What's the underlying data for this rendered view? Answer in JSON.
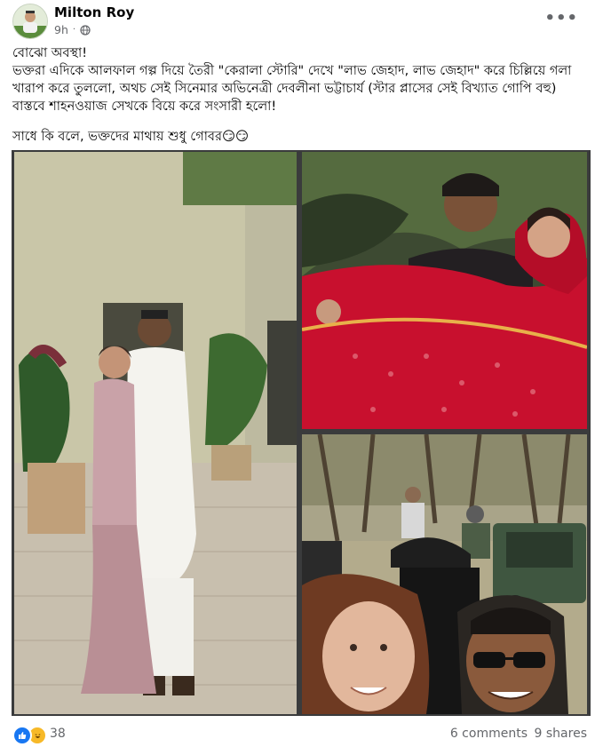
{
  "post": {
    "author": "Milton Roy",
    "time": "9h",
    "more_label": "•••",
    "text": {
      "line1": "বোঝো অবস্থা!",
      "line2": "ভক্তরা এদিকে আলফাল গল্প দিয়ে তৈরী \"কেরালা স্টোরি\" দেখে \"লাভ জেহাদ, লাভ জেহাদ\" করে চিল্লিয়ে গলা খারাপ করে তুললো, অথচ সেই সিনেমার অভিনেত্রী দেবলীনা ভট্টাচার্য (স্টার প্লাসের সেই বিখ্যাত গোপি বহু) বাস্তবে শাহনওয়াজ সেখকে বিয়ে করে সংসারী হলো!",
      "line3": "সাধে কি বলে, ভক্তদের মাথায় শুধু গোবর😏😏"
    },
    "icons": {
      "avatar": "avatar-photo",
      "globe": "globe-icon",
      "more": "more-options-icon",
      "like": "like-reaction-icon",
      "haha": "haha-reaction-icon"
    },
    "photos": [
      {
        "name": "photo-couple-standing"
      },
      {
        "name": "photo-couple-carry"
      },
      {
        "name": "photo-selfie-safari"
      }
    ]
  },
  "footer": {
    "reaction_count": "38",
    "comments": "6 comments",
    "shares": "9 shares"
  },
  "colors": {
    "meta_gray": "#65676b",
    "like_blue": "#1877f2",
    "haha_yellow": "#f7b928",
    "red_dress": "#c8102e"
  }
}
